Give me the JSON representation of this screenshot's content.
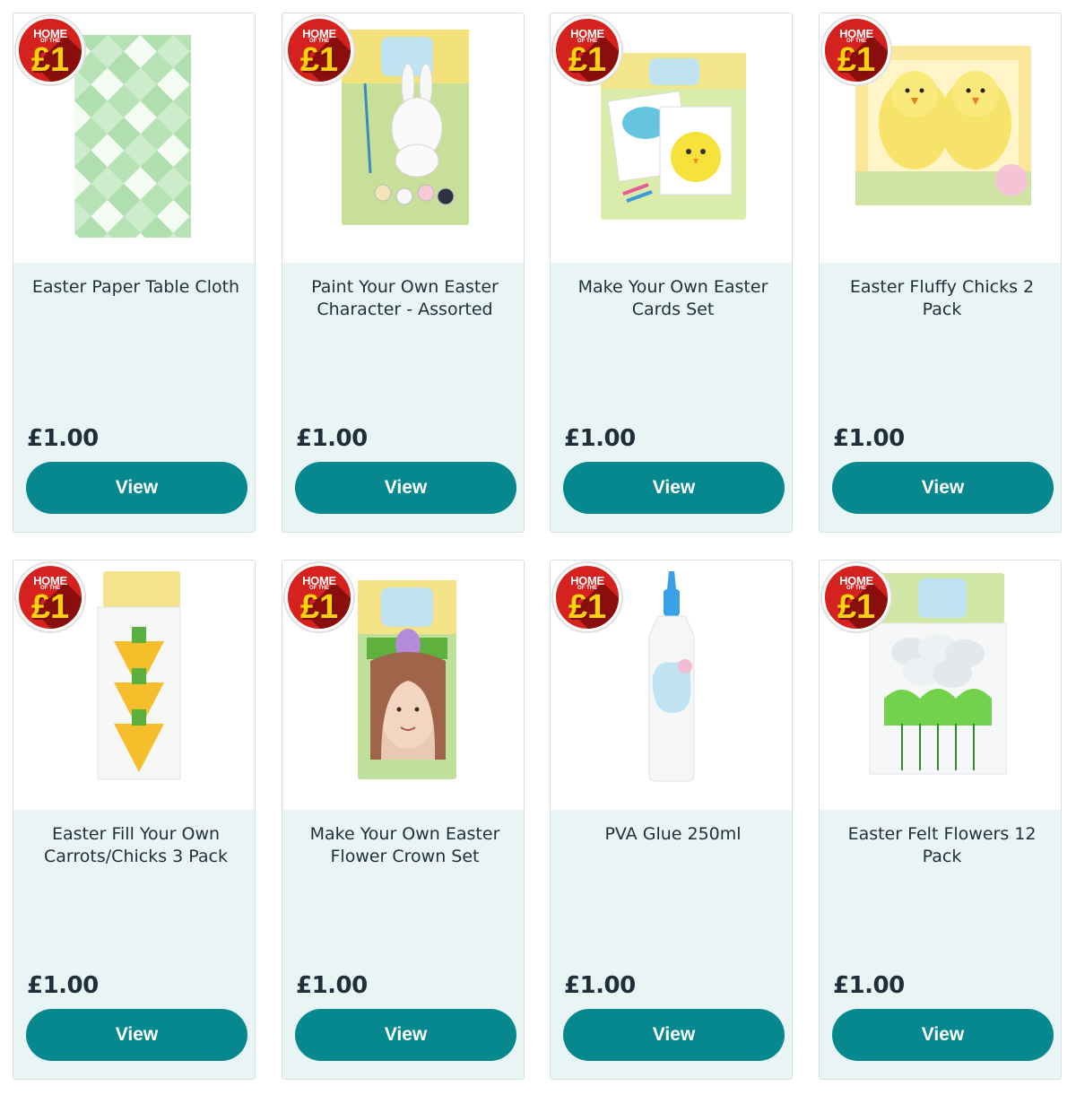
{
  "badge": {
    "line1": "HOME",
    "line2": "OF THE",
    "value": "£1"
  },
  "products": [
    {
      "title": "Easter Paper Table Cloth",
      "price": "£1.00",
      "cta": "View",
      "image_icon": "tablecloth-product-image"
    },
    {
      "title": "Paint Your Own Easter Character - Assorted",
      "price": "£1.00",
      "cta": "View",
      "image_icon": "paint-bunny-product-image"
    },
    {
      "title": "Make Your Own Easter Cards Set",
      "price": "£1.00",
      "cta": "View",
      "image_icon": "easter-cards-product-image"
    },
    {
      "title": "Easter Fluffy Chicks 2 Pack",
      "price": "£1.00",
      "cta": "View",
      "image_icon": "fluffy-chicks-product-image"
    },
    {
      "title": "Easter Fill Your Own Carrots/Chicks 3 Pack",
      "price": "£1.00",
      "cta": "View",
      "image_icon": "fill-carrots-product-image"
    },
    {
      "title": "Make Your Own Easter Flower Crown Set",
      "price": "£1.00",
      "cta": "View",
      "image_icon": "flower-crown-product-image"
    },
    {
      "title": "PVA Glue 250ml",
      "price": "£1.00",
      "cta": "View",
      "image_icon": "pva-glue-product-image"
    },
    {
      "title": "Easter Felt Flowers 12 Pack",
      "price": "£1.00",
      "cta": "View",
      "image_icon": "felt-flowers-product-image"
    }
  ],
  "colors": {
    "button": "#07888f",
    "card_bg": "#e9f5f5",
    "badge_red": "#d6221e",
    "badge_yellow": "#ffd20a"
  }
}
